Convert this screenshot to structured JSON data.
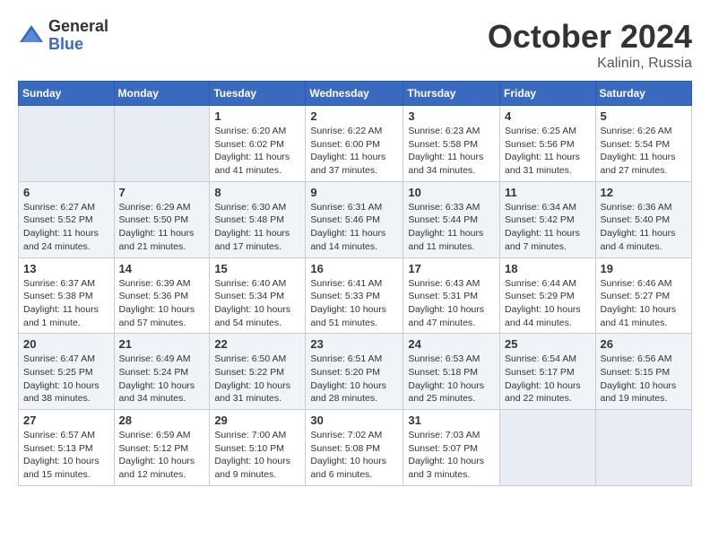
{
  "header": {
    "logo": {
      "general": "General",
      "blue": "Blue"
    },
    "title": "October 2024",
    "location": "Kalinin, Russia"
  },
  "weekdays": [
    "Sunday",
    "Monday",
    "Tuesday",
    "Wednesday",
    "Thursday",
    "Friday",
    "Saturday"
  ],
  "weeks": [
    [
      {
        "day": "",
        "info": ""
      },
      {
        "day": "",
        "info": ""
      },
      {
        "day": "1",
        "info": "Sunrise: 6:20 AM\nSunset: 6:02 PM\nDaylight: 11 hours and 41 minutes."
      },
      {
        "day": "2",
        "info": "Sunrise: 6:22 AM\nSunset: 6:00 PM\nDaylight: 11 hours and 37 minutes."
      },
      {
        "day": "3",
        "info": "Sunrise: 6:23 AM\nSunset: 5:58 PM\nDaylight: 11 hours and 34 minutes."
      },
      {
        "day": "4",
        "info": "Sunrise: 6:25 AM\nSunset: 5:56 PM\nDaylight: 11 hours and 31 minutes."
      },
      {
        "day": "5",
        "info": "Sunrise: 6:26 AM\nSunset: 5:54 PM\nDaylight: 11 hours and 27 minutes."
      }
    ],
    [
      {
        "day": "6",
        "info": "Sunrise: 6:27 AM\nSunset: 5:52 PM\nDaylight: 11 hours and 24 minutes."
      },
      {
        "day": "7",
        "info": "Sunrise: 6:29 AM\nSunset: 5:50 PM\nDaylight: 11 hours and 21 minutes."
      },
      {
        "day": "8",
        "info": "Sunrise: 6:30 AM\nSunset: 5:48 PM\nDaylight: 11 hours and 17 minutes."
      },
      {
        "day": "9",
        "info": "Sunrise: 6:31 AM\nSunset: 5:46 PM\nDaylight: 11 hours and 14 minutes."
      },
      {
        "day": "10",
        "info": "Sunrise: 6:33 AM\nSunset: 5:44 PM\nDaylight: 11 hours and 11 minutes."
      },
      {
        "day": "11",
        "info": "Sunrise: 6:34 AM\nSunset: 5:42 PM\nDaylight: 11 hours and 7 minutes."
      },
      {
        "day": "12",
        "info": "Sunrise: 6:36 AM\nSunset: 5:40 PM\nDaylight: 11 hours and 4 minutes."
      }
    ],
    [
      {
        "day": "13",
        "info": "Sunrise: 6:37 AM\nSunset: 5:38 PM\nDaylight: 11 hours and 1 minute."
      },
      {
        "day": "14",
        "info": "Sunrise: 6:39 AM\nSunset: 5:36 PM\nDaylight: 10 hours and 57 minutes."
      },
      {
        "day": "15",
        "info": "Sunrise: 6:40 AM\nSunset: 5:34 PM\nDaylight: 10 hours and 54 minutes."
      },
      {
        "day": "16",
        "info": "Sunrise: 6:41 AM\nSunset: 5:33 PM\nDaylight: 10 hours and 51 minutes."
      },
      {
        "day": "17",
        "info": "Sunrise: 6:43 AM\nSunset: 5:31 PM\nDaylight: 10 hours and 47 minutes."
      },
      {
        "day": "18",
        "info": "Sunrise: 6:44 AM\nSunset: 5:29 PM\nDaylight: 10 hours and 44 minutes."
      },
      {
        "day": "19",
        "info": "Sunrise: 6:46 AM\nSunset: 5:27 PM\nDaylight: 10 hours and 41 minutes."
      }
    ],
    [
      {
        "day": "20",
        "info": "Sunrise: 6:47 AM\nSunset: 5:25 PM\nDaylight: 10 hours and 38 minutes."
      },
      {
        "day": "21",
        "info": "Sunrise: 6:49 AM\nSunset: 5:24 PM\nDaylight: 10 hours and 34 minutes."
      },
      {
        "day": "22",
        "info": "Sunrise: 6:50 AM\nSunset: 5:22 PM\nDaylight: 10 hours and 31 minutes."
      },
      {
        "day": "23",
        "info": "Sunrise: 6:51 AM\nSunset: 5:20 PM\nDaylight: 10 hours and 28 minutes."
      },
      {
        "day": "24",
        "info": "Sunrise: 6:53 AM\nSunset: 5:18 PM\nDaylight: 10 hours and 25 minutes."
      },
      {
        "day": "25",
        "info": "Sunrise: 6:54 AM\nSunset: 5:17 PM\nDaylight: 10 hours and 22 minutes."
      },
      {
        "day": "26",
        "info": "Sunrise: 6:56 AM\nSunset: 5:15 PM\nDaylight: 10 hours and 19 minutes."
      }
    ],
    [
      {
        "day": "27",
        "info": "Sunrise: 6:57 AM\nSunset: 5:13 PM\nDaylight: 10 hours and 15 minutes."
      },
      {
        "day": "28",
        "info": "Sunrise: 6:59 AM\nSunset: 5:12 PM\nDaylight: 10 hours and 12 minutes."
      },
      {
        "day": "29",
        "info": "Sunrise: 7:00 AM\nSunset: 5:10 PM\nDaylight: 10 hours and 9 minutes."
      },
      {
        "day": "30",
        "info": "Sunrise: 7:02 AM\nSunset: 5:08 PM\nDaylight: 10 hours and 6 minutes."
      },
      {
        "day": "31",
        "info": "Sunrise: 7:03 AM\nSunset: 5:07 PM\nDaylight: 10 hours and 3 minutes."
      },
      {
        "day": "",
        "info": ""
      },
      {
        "day": "",
        "info": ""
      }
    ]
  ]
}
